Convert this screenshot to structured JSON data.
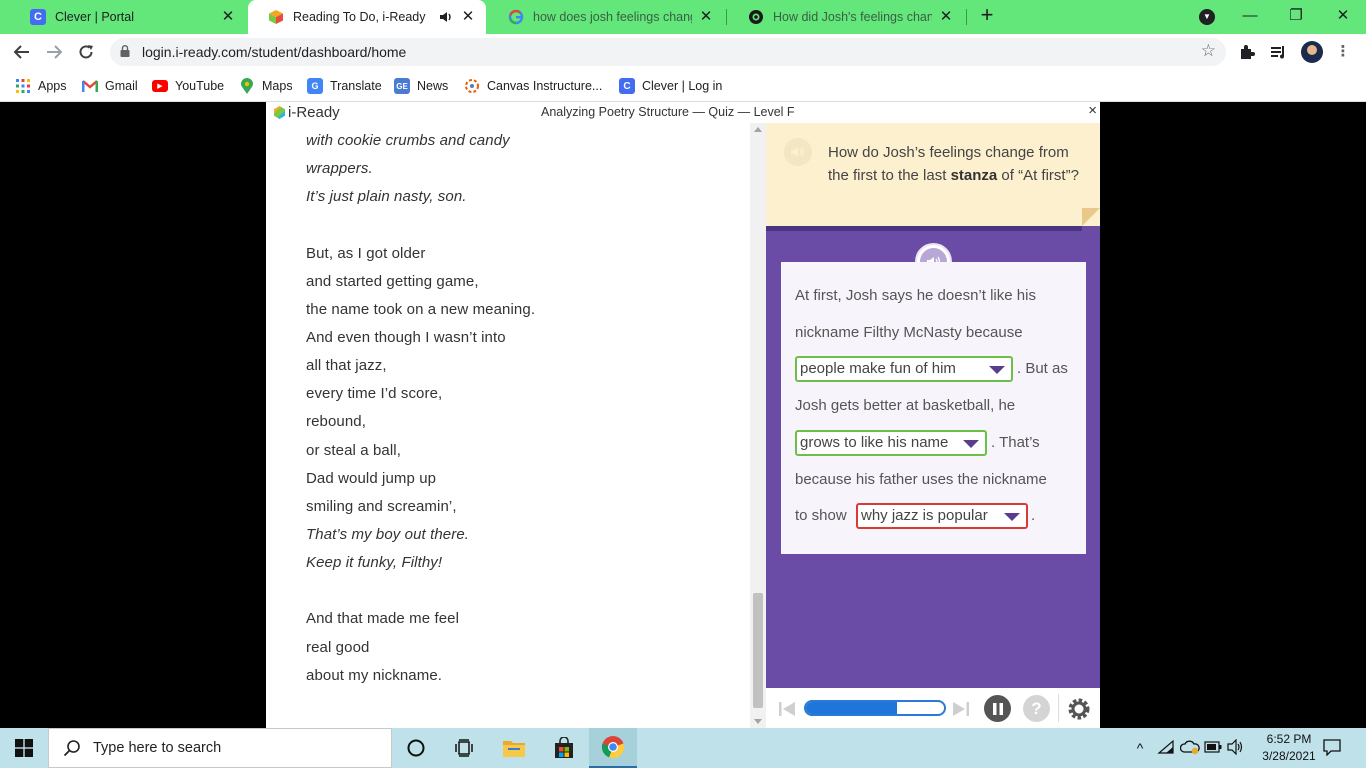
{
  "browser": {
    "tabs": [
      {
        "title": "Clever | Portal",
        "favicon": "clever-c",
        "active": false
      },
      {
        "title": "Reading To Do, i-Ready",
        "favicon": "iready-cube",
        "active": true,
        "audio": true
      },
      {
        "title": "how does josh feelings change fr",
        "favicon": "google-g",
        "active": false
      },
      {
        "title": "How did Josh's feelings change f",
        "favicon": "brainly",
        "active": false
      }
    ],
    "new_tab_label": "+",
    "url": "login.i-ready.com/student/dashboard/home",
    "bookmarks": [
      {
        "label": "Apps",
        "icon": "apps-grid-icon"
      },
      {
        "label": "Gmail",
        "icon": "gmail-icon"
      },
      {
        "label": "YouTube",
        "icon": "youtube-icon"
      },
      {
        "label": "Maps",
        "icon": "maps-icon"
      },
      {
        "label": "Translate",
        "icon": "translate-icon"
      },
      {
        "label": "News",
        "icon": "news-icon"
      },
      {
        "label": "Canvas Instructure...",
        "icon": "canvas-icon"
      },
      {
        "label": "Clever | Log in",
        "icon": "clever-icon"
      }
    ]
  },
  "app": {
    "brand": "i-Ready",
    "quiz_title": "Analyzing Poetry Structure — Quiz — Level F",
    "close_label": "×",
    "poem_lines": [
      {
        "text": "with cookie crumbs and candy",
        "italic": true
      },
      {
        "text": "wrappers.",
        "italic": true
      },
      {
        "text": "It’s just plain nasty, son.",
        "italic": true
      },
      {
        "text": "But, as I got older",
        "italic": false
      },
      {
        "text": "and started getting game,",
        "italic": false
      },
      {
        "text": "the name took on a new meaning.",
        "italic": false
      },
      {
        "text": "And even though I wasn’t into",
        "italic": false
      },
      {
        "text": "all that jazz,",
        "italic": false
      },
      {
        "text": "every time I’d score,",
        "italic": false
      },
      {
        "text": "rebound,",
        "italic": false
      },
      {
        "text": "or steal a ball,",
        "italic": false
      },
      {
        "text": "Dad would jump up",
        "italic": false
      },
      {
        "text": "smiling and screamin’,",
        "italic": false
      },
      {
        "text": "That’s my boy out there.",
        "italic": true
      },
      {
        "text": "Keep it funky, Filthy!",
        "italic": true
      },
      {
        "text": "And that made me feel",
        "italic": false
      },
      {
        "text": "real good",
        "italic": false
      },
      {
        "text": "about my nickname.",
        "italic": false
      }
    ],
    "question": {
      "before": "How do Josh’s feelings change from the first to the last ",
      "bold": "stanza",
      "after": " of “At first”?"
    },
    "answer": {
      "line1": "At first, Josh says he doesn’t like his",
      "line2": "nickname Filthy McNasty because",
      "dropdown1": "people make fun of him",
      "after_dd1": ". But as",
      "line4": "Josh gets better at basketball, he",
      "dropdown2": "grows to like his name",
      "after_dd2": ". That’s",
      "line6": "because his father uses the nickname",
      "line7_start": "to show",
      "dropdown3": "why jazz is popular",
      "after_dd3": "."
    },
    "progress_fraction": 0.66,
    "colors": {
      "panel_purple": "#6a4ba6",
      "question_bg": "#fdf0cf",
      "correct_green": "#6dbf4a",
      "incorrect_red": "#d93a35",
      "progress_blue": "#1f76d9"
    }
  },
  "taskbar": {
    "search_placeholder": "Type here to search",
    "time": "6:52 PM",
    "date": "3/28/2021"
  }
}
